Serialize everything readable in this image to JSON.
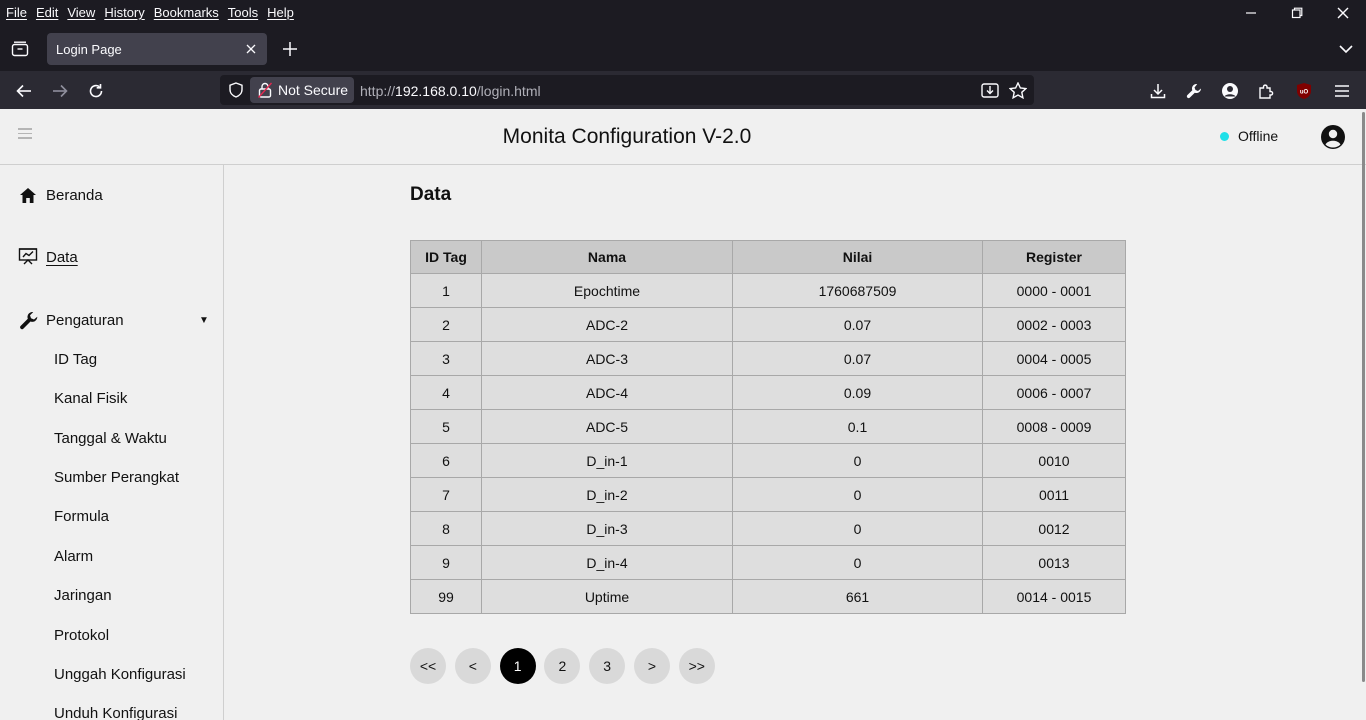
{
  "browser": {
    "menus": [
      "File",
      "Edit",
      "View",
      "History",
      "Bookmarks",
      "Tools",
      "Help"
    ],
    "tab_title": "Login Page",
    "security_label": "Not Secure",
    "url_prefix": "http://",
    "url_host": "192.168.0.10",
    "url_path": "/login.html"
  },
  "header": {
    "title": "Monita Configuration V-2.0",
    "status": "Offline",
    "status_color": "#1fe0e8"
  },
  "sidebar": {
    "main": [
      {
        "label": "Beranda",
        "icon": "home-icon"
      },
      {
        "label": "Data",
        "icon": "presentation-board-icon"
      },
      {
        "label": "Pengaturan",
        "icon": "wrench-icon"
      }
    ],
    "sub": [
      "ID Tag",
      "Kanal Fisik",
      "Tanggal & Waktu",
      "Sumber Perangkat",
      "Formula",
      "Alarm",
      "Jaringan",
      "Protokol",
      "Unggah Konfigurasi",
      "Unduh Konfigurasi"
    ]
  },
  "content": {
    "title": "Data",
    "columns": [
      "ID Tag",
      "Nama",
      "Nilai",
      "Register"
    ],
    "rows": [
      [
        "1",
        "Epochtime",
        "1760687509",
        "0000 - 0001"
      ],
      [
        "2",
        "ADC-2",
        "0.07",
        "0002 - 0003"
      ],
      [
        "3",
        "ADC-3",
        "0.07",
        "0004 - 0005"
      ],
      [
        "4",
        "ADC-4",
        "0.09",
        "0006 - 0007"
      ],
      [
        "5",
        "ADC-5",
        "0.1",
        "0008 - 0009"
      ],
      [
        "6",
        "D_in-1",
        "0",
        "0010"
      ],
      [
        "7",
        "D_in-2",
        "0",
        "0011"
      ],
      [
        "8",
        "D_in-3",
        "0",
        "0012"
      ],
      [
        "9",
        "D_in-4",
        "0",
        "0013"
      ],
      [
        "99",
        "Uptime",
        "661",
        "0014 - 0015"
      ]
    ]
  },
  "pagination": [
    "<<",
    "<",
    "1",
    "2",
    "3",
    ">",
    ">>"
  ],
  "pagination_active": "1"
}
